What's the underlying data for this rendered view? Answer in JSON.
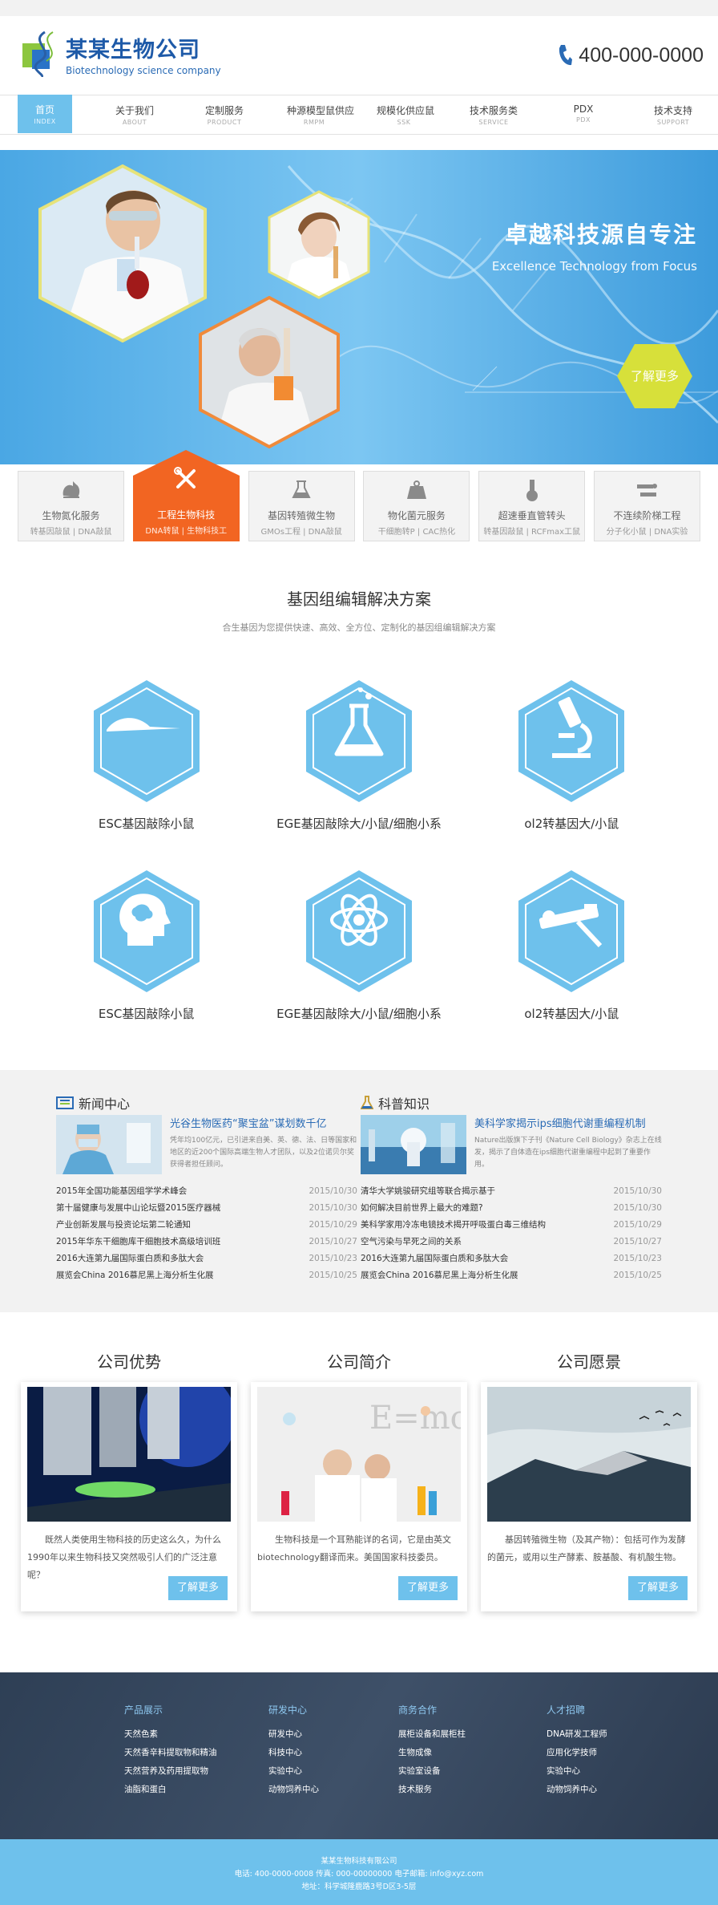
{
  "header": {
    "company_name": "某某生物公司",
    "company_en": "Biotechnology science company",
    "phone": "400-000-0000"
  },
  "nav": [
    {
      "label": "首页",
      "en": "INDEX"
    },
    {
      "label": "关于我们",
      "en": "ABOUT"
    },
    {
      "label": "定制服务",
      "en": "PRODUCT"
    },
    {
      "label": "种源模型鼠供应",
      "en": "RMPM"
    },
    {
      "label": "规模化供应鼠",
      "en": "SSK"
    },
    {
      "label": "技术服务类",
      "en": "SERVICE"
    },
    {
      "label": "PDX",
      "en": "PDX"
    },
    {
      "label": "技术支持",
      "en": "SUPPORT"
    }
  ],
  "banner": {
    "slogan_cn": "卓越科技源自专注",
    "slogan_en": "Excellence Technology from Focus",
    "more_label": "了解更多"
  },
  "services": [
    {
      "label": "生物氮化服务",
      "sub": "转基因敲鼠 | DNA敲鼠",
      "icon": "mouse-icon"
    },
    {
      "label": "工程生物科技",
      "sub": "DNA转鼠 | 生物科技工",
      "icon": "tools-icon"
    },
    {
      "label": "基因转殖微生物",
      "sub": "GMOs工程 | DNA敲鼠",
      "icon": "flask-icon"
    },
    {
      "label": "物化菌元服务",
      "sub": "干细胞转P | CAC热化",
      "icon": "weight-icon"
    },
    {
      "label": "超速垂直管转头",
      "sub": "转基因敲鼠 | RCFmax工鼠",
      "icon": "tube-icon"
    },
    {
      "label": "不连续阶梯工程",
      "sub": "分子化小鼠 | DNA实验",
      "icon": "dropper-icon"
    }
  ],
  "solutions": {
    "title": "基因组编辑解决方案",
    "subtitle": "合生基因为您提供快速、高效、全方位、定制化的基因组编辑解决方案",
    "items": [
      {
        "label": "ESC基因敲除小鼠",
        "icon": "mouse-icon"
      },
      {
        "label": "EGE基因敲除大/小鼠/细胞小系",
        "icon": "flask-icon"
      },
      {
        "label": "ol2转基因大/小鼠",
        "icon": "microscope-icon"
      },
      {
        "label": "ESC基因敲除小鼠",
        "icon": "head-icon"
      },
      {
        "label": "EGE基因敲除大/小鼠/细胞小系",
        "icon": "atom-icon"
      },
      {
        "label": "ol2转基因大/小鼠",
        "icon": "pipette-icon"
      }
    ]
  },
  "news": {
    "title": "新闻中心",
    "featured_title": "光谷生物医药“聚宝盆”谋划数千亿",
    "featured_desc": "凭年均100亿元，已引进来自美、英、德、法、日等国家和地区的近200个国际高端生物人才团队，以及2位诺贝尔奖获得者担任顾问。",
    "items": [
      {
        "title": "2015年全国功能基因组学学术峰会",
        "date": "2015/10/30"
      },
      {
        "title": "第十届健康与发展中山论坛暨2015医疗器械",
        "date": "2015/10/30"
      },
      {
        "title": "产业创新发展与投资论坛第二轮通知",
        "date": "2015/10/29"
      },
      {
        "title": "2015年华东干细胞库干细胞技术高级培训班",
        "date": "2015/10/27"
      },
      {
        "title": "2016大连第九届国际蛋白质和多肽大会",
        "date": "2015/10/23"
      },
      {
        "title": "展览会China 2016慕尼黑上海分析生化展",
        "date": "2015/10/25"
      }
    ]
  },
  "science": {
    "title": "科普知识",
    "featured_title": "美科学家揭示ips细胞代谢重编程机制",
    "featured_desc": "Nature出版旗下子刊《Nature Cell Biology》杂志上在线发，揭示了自体造在ips细胞代谢重编程中起到了重要作用。",
    "items": [
      {
        "title": "清华大学姚骏研究组等联合揭示基于",
        "date": "2015/10/30"
      },
      {
        "title": "如何解决目前世界上最大的难题?",
        "date": "2015/10/30"
      },
      {
        "title": "美科学家用冷冻电镜技术揭开呼吸蛋白毒三维结构",
        "date": "2015/10/29"
      },
      {
        "title": "空气污染与早死之间的关系",
        "date": "2015/10/27"
      },
      {
        "title": "2016大连第九届国际蛋白质和多肽大会",
        "date": "2015/10/23"
      },
      {
        "title": "展览会China 2016慕尼黑上海分析生化展",
        "date": "2015/10/25"
      }
    ]
  },
  "about": [
    {
      "title": "公司优势",
      "desc": "既然人类使用生物科技的历史这么久，为什么1990年以来生物科技又突然吸引人们的广泛注意呢？",
      "btn": "了解更多"
    },
    {
      "title": "公司简介",
      "desc": "生物科技是一个耳熟能详的名词，它是由英文biotechnology翻译而来。美国国家科技委员。",
      "btn": "了解更多"
    },
    {
      "title": "公司愿景",
      "desc": "基因转殖微生物（及其产物）：包括可作为发酵的菌元，或用以生产酵素、胺基酸、有机酸生物。",
      "btn": "了解更多"
    }
  ],
  "footer": {
    "columns": [
      {
        "title": "产品展示",
        "links": [
          "天然色素",
          "天然香辛料提取物和精油",
          "天然营养及药用提取物",
          "油脂和蛋白"
        ]
      },
      {
        "title": "研发中心",
        "links": [
          "研发中心",
          "科技中心",
          "实验中心",
          "动物饲养中心"
        ]
      },
      {
        "title": "商务合作",
        "links": [
          "展柜设备和展柜柱",
          "生物成像",
          "实验室设备",
          "技术服务"
        ]
      },
      {
        "title": "人才招聘",
        "links": [
          "DNA研发工程师",
          "应用化学技师",
          "实验中心",
          "动物饲养中心"
        ]
      }
    ],
    "copyright_name": "某某生物科技有限公司",
    "contact": "电话: 400-0000-0008  传真: 000-00000000  电子邮箱: info@xyz.com",
    "address": "地址：科学城隆鹿路3号D区3-5层"
  },
  "colors": {
    "accent": "#6ec1ec",
    "brand": "#1e5aa8",
    "orange": "#f26522"
  }
}
